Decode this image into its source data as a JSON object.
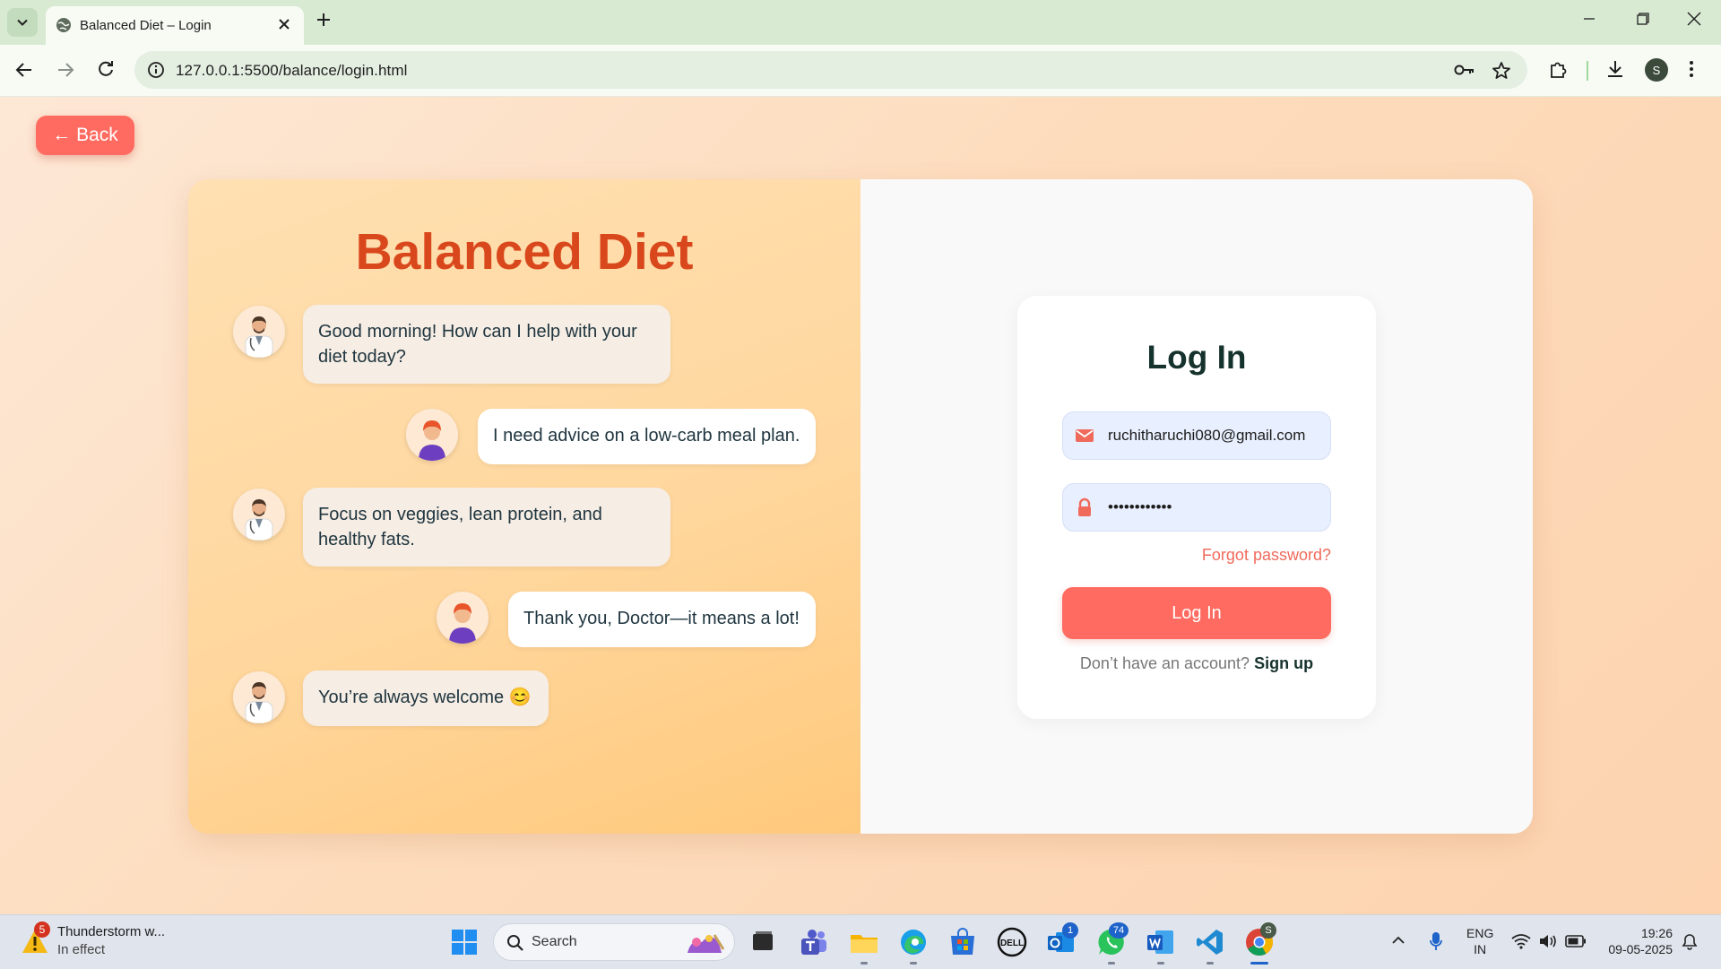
{
  "browser": {
    "tab_title": "Balanced Diet – Login",
    "url": "127.0.0.1:5500/balance/login.html",
    "profile_initial": "S"
  },
  "page": {
    "back_label": "← Back",
    "brand_title": "Balanced Diet",
    "chat": [
      {
        "from": "doctor",
        "text": "Good morning! How can I help with your diet today?"
      },
      {
        "from": "user",
        "text": "I need advice on a low-carb meal plan."
      },
      {
        "from": "doctor",
        "text": "Focus on veggies, lean protein, and healthy fats."
      },
      {
        "from": "user",
        "text": "Thank you, Doctor—it means a lot!"
      },
      {
        "from": "doctor",
        "text": "You’re always welcome 😊"
      }
    ],
    "login": {
      "title": "Log In",
      "email_value": "ruchitharuchi080@gmail.com",
      "password_value": "••••••••••••",
      "forgot_label": "Forgot password?",
      "button_label": "Log In",
      "signup_prompt": "Don’t have an account?",
      "signup_label": "Sign up"
    },
    "colors": {
      "accent": "#ff6b60",
      "brand_title": "#d9481c",
      "dark_text": "#16322d"
    }
  },
  "taskbar": {
    "weather_badge": "5",
    "weather_title": "Thunderstorm w...",
    "weather_subtitle": "In effect",
    "search_label": "Search",
    "outlook_badge": "1",
    "whatsapp_badge": "74",
    "chrome_badge": "S",
    "language_line1": "ENG",
    "language_line2": "IN",
    "time": "19:26",
    "date": "09-05-2025"
  }
}
